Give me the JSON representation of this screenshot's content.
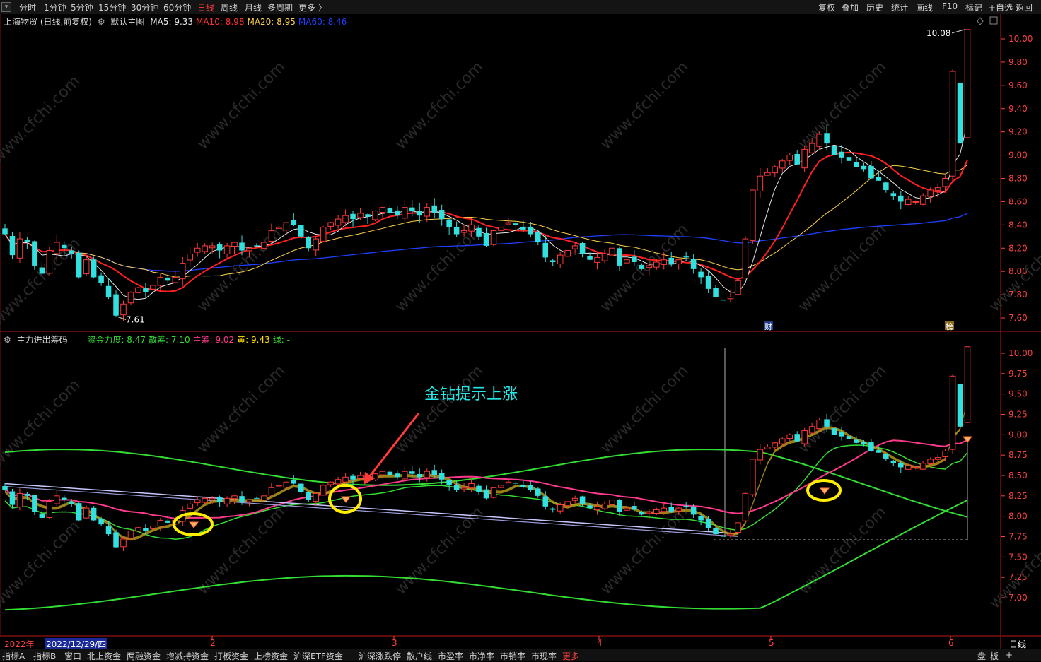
{
  "toolbar": {
    "periods": [
      {
        "label": "分时",
        "active": false
      },
      {
        "label": "1分钟",
        "active": false
      },
      {
        "label": "5分钟",
        "active": false
      },
      {
        "label": "15分钟",
        "active": false
      },
      {
        "label": "30分钟",
        "active": false
      },
      {
        "label": "60分钟",
        "active": false
      },
      {
        "label": "日线",
        "active": true
      },
      {
        "label": "周线",
        "active": false
      },
      {
        "label": "月线",
        "active": false
      },
      {
        "label": "多周期",
        "active": false
      },
      {
        "label": "更多 〉",
        "active": false
      }
    ],
    "right_buttons": [
      "复权",
      "叠加",
      "历史",
      "统计",
      "画线",
      "F10",
      "标记",
      "+自选",
      "返回"
    ]
  },
  "main_panel": {
    "stock_title": "上海物贸 (日线,前复权)",
    "indicator_name": "默认主图",
    "ma": [
      {
        "label": "MA5:",
        "value": "9.33",
        "color": "#e8e8e8"
      },
      {
        "label": "MA10:",
        "value": "8.98",
        "color": "#ff3030"
      },
      {
        "label": "MA20:",
        "value": "8.95",
        "color": "#ffd24a"
      },
      {
        "label": "MA60:",
        "value": "8.46",
        "color": "#2040ff"
      }
    ],
    "high_marker": "10.08",
    "low_marker": "7.61",
    "event_labels": [
      "财",
      "榜"
    ]
  },
  "sub_panel": {
    "indicator_name": "主力进出筹码",
    "values": [
      {
        "label": "资金力度:",
        "value": "8.47",
        "color": "#33dd33"
      },
      {
        "label": "散筹:",
        "value": "7.10",
        "color": "#33dd33"
      },
      {
        "label": "主筹:",
        "value": "9.02",
        "color": "#ff3a8c"
      },
      {
        "label": "黄:",
        "value": "9.43",
        "color": "#ffe000"
      },
      {
        "label": "绿:",
        "value": "-",
        "color": "#33dd33"
      }
    ],
    "annotation": "金钻提示上涨"
  },
  "dates": {
    "year_label": "2022年",
    "cursor_date": "2022/12/29/四",
    "month_ticks": [
      "2",
      "3",
      "4",
      "5",
      "6"
    ],
    "period": "日线"
  },
  "bottom_tabs": [
    "指标A",
    "指标B",
    "窗口",
    "北上资金",
    "两融资金",
    "增减持资金",
    "打板资金",
    "上榜资金",
    "沪深ETF资金",
    "沪深涨跌停",
    "散户线",
    "市盈率",
    "市净率",
    "市销率",
    "市现率",
    "更多"
  ],
  "bottom_right": [
    "盘",
    "板",
    "+"
  ],
  "watermark": "www.cfchi.com",
  "colors": {
    "up": "#ff3a3a",
    "down": "#33e0e0",
    "ma5": "#e8e8e8",
    "ma10": "#ff2020",
    "ma20": "#ffd24a",
    "ma60": "#2040ff",
    "grid": "#7a1010",
    "axis": "#ff4040"
  },
  "chart_data": [
    {
      "type": "candlestick",
      "title": "上海物贸 (日线,前复权)",
      "y_ticks": [
        "7.60",
        "7.80",
        "8.00",
        "8.20",
        "8.40",
        "8.60",
        "8.80",
        "9.00",
        "9.20",
        "9.40",
        "9.60",
        "9.80",
        "10.00"
      ],
      "ylim": [
        7.58,
        10.14
      ],
      "x_range": [
        "2022-12",
        "2023-06"
      ],
      "grid": true,
      "close": [
        8.32,
        8.14,
        8.28,
        8.25,
        8.05,
        7.98,
        8.18,
        8.25,
        8.2,
        8.15,
        7.95,
        8.1,
        7.95,
        7.9,
        7.78,
        7.62,
        7.72,
        7.82,
        7.86,
        7.82,
        7.88,
        7.95,
        7.92,
        7.95,
        8.07,
        8.15,
        8.2,
        8.22,
        8.22,
        8.18,
        8.22,
        8.25,
        8.18,
        8.2,
        8.22,
        8.25,
        8.35,
        8.38,
        8.42,
        8.4,
        8.3,
        8.2,
        8.28,
        8.38,
        8.42,
        8.45,
        8.48,
        8.45,
        8.5,
        8.47,
        8.52,
        8.55,
        8.5,
        8.48,
        8.55,
        8.52,
        8.48,
        8.55,
        8.5,
        8.45,
        8.38,
        8.32,
        8.35,
        8.4,
        8.3,
        8.22,
        8.35,
        8.38,
        8.42,
        8.4,
        8.36,
        8.32,
        8.25,
        8.12,
        8.08,
        8.14,
        8.18,
        8.22,
        8.15,
        8.1,
        8.12,
        8.15,
        8.2,
        8.05,
        8.1,
        8.08,
        8.02,
        8.05,
        8.08,
        8.1,
        8.06,
        8.1,
        8.12,
        8.02,
        7.95,
        7.85,
        7.78,
        7.75,
        7.78,
        7.92,
        8.28,
        8.7,
        8.82,
        8.85,
        8.9,
        8.95,
        9.0,
        8.92,
        9.05,
        9.1,
        9.18,
        9.1,
        9.0,
        8.98,
        8.95,
        8.9,
        8.88,
        8.8,
        8.78,
        8.7,
        8.65,
        8.6,
        8.62,
        8.6,
        8.65,
        8.7,
        8.72,
        8.8,
        9.72,
        9.1,
        10.08
      ],
      "ma_series": [
        {
          "name": "MA5",
          "last": 9.33
        },
        {
          "name": "MA10",
          "last": 8.98
        },
        {
          "name": "MA20",
          "last": 8.95
        },
        {
          "name": "MA60",
          "last": 8.46
        }
      ]
    },
    {
      "type": "line",
      "title": "主力进出筹码",
      "y_ticks": [
        "7.00",
        "7.25",
        "7.50",
        "7.75",
        "8.00",
        "8.25",
        "8.50",
        "8.75",
        "9.00",
        "9.25",
        "9.50",
        "9.75",
        "10.00"
      ],
      "ylim": [
        6.85,
        10.07
      ],
      "series": [
        {
          "name": "资金力度",
          "last": 8.47
        },
        {
          "name": "散筹",
          "last": 7.1
        },
        {
          "name": "主筹",
          "last": 9.02
        },
        {
          "name": "黄",
          "last": 9.43
        },
        {
          "name": "绿",
          "last": null
        }
      ],
      "diamond_signals": 3
    }
  ]
}
